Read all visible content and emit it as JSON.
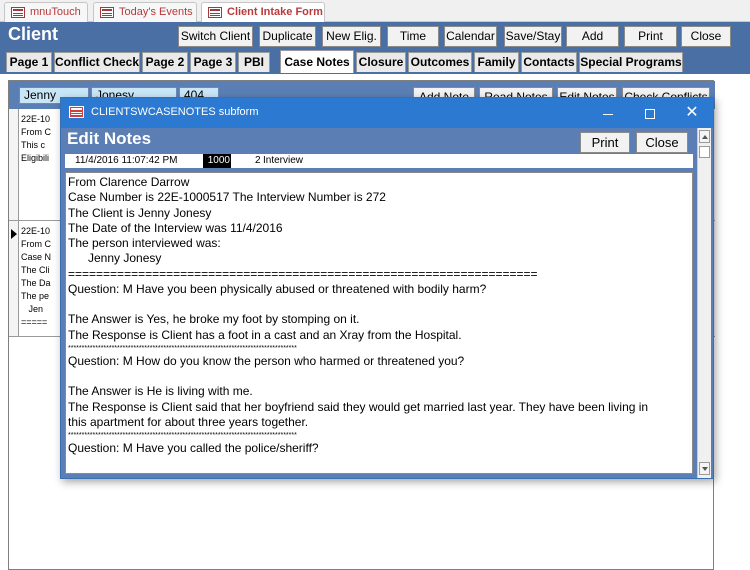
{
  "doc_tabs": [
    {
      "label": "mnuTouch"
    },
    {
      "label": "Today's Events"
    },
    {
      "label": "Client Intake Form"
    }
  ],
  "form_title": "Client",
  "header_buttons": {
    "switch_client": "Switch Client",
    "duplicate": "Duplicate",
    "new_elig": "New Elig.",
    "time": "Time",
    "calendar": "Calendar",
    "save_stay": "Save/Stay",
    "add": "Add",
    "print": "Print",
    "close": "Close"
  },
  "page_tabs": [
    "Page 1",
    "Conflict Check",
    "Page 2",
    "Page 3",
    "PBI",
    "Case Notes",
    "Closure",
    "Outcomes",
    "Family",
    "Contacts",
    "Special Programs"
  ],
  "active_tab": "Case Notes",
  "client_fields": {
    "first_name": "Jenny",
    "last_name": "Jonesy",
    "number": "404"
  },
  "notes_buttons": {
    "add_note": "Add Note",
    "read_notes": "Read Notes",
    "edit_notes": "Edit Notes",
    "check_conflicts": "Check Conflicts"
  },
  "background_rows": [
    {
      "lines": [
        "22E-10",
        "From C",
        "This c",
        "Eligibili"
      ]
    },
    {
      "lines": [
        "22E-10",
        "From C",
        "Case N",
        "The Cli",
        "The Da",
        "The pe",
        "   Jen",
        "====="
      ]
    }
  ],
  "popup": {
    "window_title": "CLIENTSWCASENOTES subform",
    "heading": "Edit Notes",
    "print_label": "Print",
    "close_label": "Close",
    "date": "11/4/2016 11:07:42 PM",
    "code": "1000",
    "num": "2",
    "type": "Interview",
    "notes_lines": [
      "From Clarence Darrow",
      "Case Number is 22E-1000517     The Interview Number is 272",
      "The Client is Jenny Jonesy",
      "The Date of the Interview was 11/4/2016",
      "The person interviewed was:",
      "      Jenny Jonesy",
      "===================================================================",
      "Question:  M  Have you been physically abused or threatened with bodily harm?",
      "",
      "The Answer is Yes, he broke my foot by stomping on it.",
      "The Response is Client has a foot in a cast and an Xray from the Hospital.",
      "************************************************************************************",
      "Question:  M  How do you know the person who harmed or threatened you?",
      "",
      "The Answer is He is living with me.",
      "The Response is Client said that her boyfriend said they would get married last year. They have been living in",
      "this apartment for about three years together.",
      "************************************************************************************",
      "Question:  M  Have you called the police/sheriff?"
    ]
  }
}
